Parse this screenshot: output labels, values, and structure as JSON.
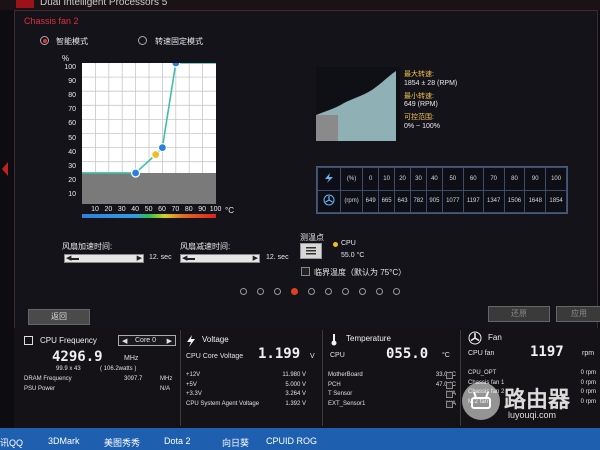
{
  "window": {
    "title": "Dual Intelligent Processors 5"
  },
  "fan_panel": {
    "title": "Chassis fan 2",
    "mode_smart": "智能模式",
    "mode_fixed": "转速固定模式",
    "y_unit": "%",
    "y_ticks": [
      "100",
      "90",
      "80",
      "70",
      "60",
      "50",
      "40",
      "30",
      "20",
      "10"
    ],
    "x_ticks": [
      "10",
      "20",
      "30",
      "40",
      "50",
      "60",
      "70",
      "80",
      "90",
      "100"
    ],
    "x_unit": "°C",
    "accel_label": "风扇加速时间:",
    "accel_value": "12. sec",
    "decel_label": "风扇减速时间:",
    "decel_value": "12. sec",
    "measure_label": "测温点",
    "sensor_name": "CPU",
    "sensor_temp": "55.0 °C",
    "critical_label": "临界温度（默认为 75°C）",
    "max_speed_label": "最大转速:",
    "max_speed_value": "1854 ± 28 (RPM)",
    "min_speed_label": "最小转速:",
    "min_speed_value": "649 (RPM)",
    "range_label": "可控范围:",
    "range_value": "0% ~ 100%",
    "table_row1": [
      "(%)",
      "0",
      "10",
      "20",
      "30",
      "40",
      "50",
      "60",
      "70",
      "80",
      "90",
      "100"
    ],
    "table_row2": [
      "(rpm)",
      "649",
      "665",
      "643",
      "782",
      "905",
      "1077",
      "1197",
      "1347",
      "1506",
      "1648",
      "1854"
    ],
    "page_dots": 10,
    "active_dot": 3,
    "back_button": "返回",
    "undo_button": "还原",
    "apply_button": "应用"
  },
  "chart_data": {
    "type": "line",
    "x": [
      0,
      40,
      55,
      60,
      70,
      80
    ],
    "y": [
      22,
      22,
      35,
      40,
      100,
      100
    ],
    "control_points": [
      [
        40,
        22
      ],
      [
        55,
        35
      ],
      [
        60,
        40
      ],
      [
        70,
        100
      ]
    ],
    "highlight_point": [
      55,
      35
    ],
    "xlim": [
      0,
      100
    ],
    "ylim": [
      0,
      100
    ],
    "xlabel": "°C",
    "ylabel": "%",
    "grid": true
  },
  "monitor": {
    "cpu_freq": {
      "title": "CPU Frequency",
      "core_select": "Core 0",
      "value": "4296.9",
      "unit": "MHz",
      "sub": "99.9 x 43",
      "sub2": "( 106.2watts )",
      "dram_label": "DRAM Frequency",
      "dram_value": "3097.7",
      "dram_unit": "MHz",
      "psu_label": "PSU Power",
      "psu_value": "N/A"
    },
    "voltage": {
      "title": "Voltage",
      "main_label": "CPU Core Voltage",
      "main_value": "1.199",
      "main_unit": "V",
      "rows": [
        {
          "label": "+12V",
          "value": "11.980 V"
        },
        {
          "label": "+5V",
          "value": "5.000 V"
        },
        {
          "label": "+3.3V",
          "value": "3.264 V"
        },
        {
          "label": "CPU System Agent Voltage",
          "value": "1.392 V"
        }
      ]
    },
    "temperature": {
      "title": "Temperature",
      "main_label": "CPU",
      "main_value": "055.0",
      "main_unit": "°C",
      "rows": [
        {
          "label": "MotherBoard",
          "value": "33.0 °C"
        },
        {
          "label": "PCH",
          "value": "47.0 °C"
        },
        {
          "label": "T Sensor",
          "value": "N/A"
        },
        {
          "label": "EXT_Sensor1",
          "value": "N/A"
        }
      ]
    },
    "fan": {
      "title": "Fan",
      "main_label": "CPU fan",
      "main_value": "1197",
      "main_unit": "rpm",
      "rows": [
        {
          "label": "CPU_OPT",
          "value": "0 rpm"
        },
        {
          "label": "Chassis fan 1",
          "value": "0 rpm"
        },
        {
          "label": "Chassis fan 2",
          "value": "0 rpm"
        },
        {
          "label": "M.2 fan",
          "value": "0 rpm"
        }
      ]
    }
  },
  "taskbar": {
    "items": [
      "讯QQ",
      "3DMark",
      "美图秀秀",
      "Dota 2",
      "向日葵",
      "CPUID ROG"
    ]
  },
  "watermark": {
    "text": "路由器",
    "url": "luyouqi.com"
  }
}
